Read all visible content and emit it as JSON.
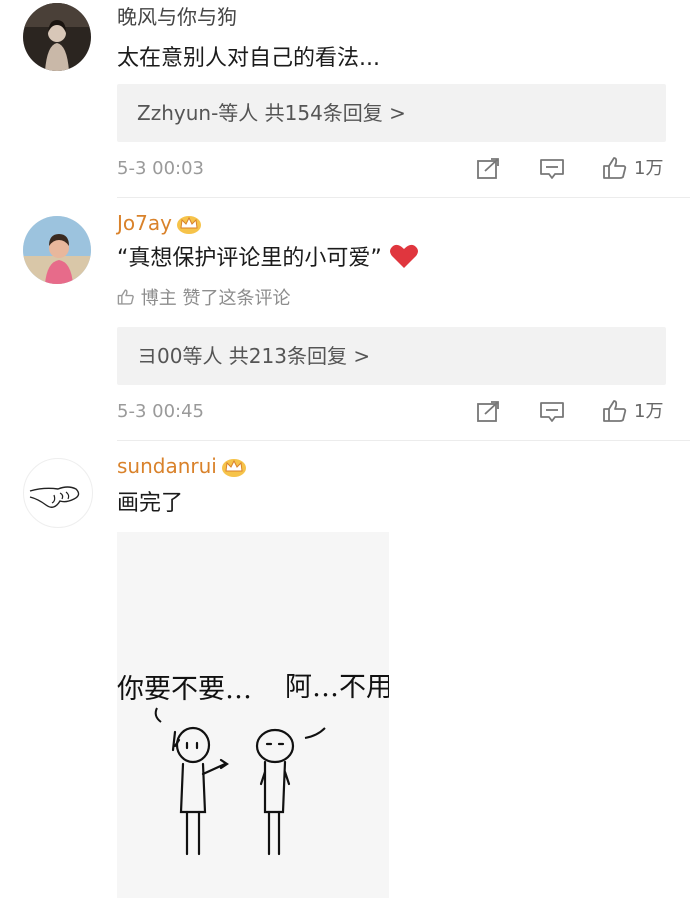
{
  "comments": [
    {
      "username": "晚风与你与狗",
      "text": "太在意别人对自己的看法...",
      "replies": "Zzhyun-等人  共154条回复 >",
      "time": "5-3 00:03",
      "likes": "1万"
    },
    {
      "username": "Jo7ay",
      "text": "“真想保护评论里的小可爱”",
      "liked_by": "博主 赞了这条评论",
      "replies": "ヨ00等人  共213条回复 >",
      "time": "5-3 00:45",
      "likes": "1万"
    },
    {
      "username": "sundanrui",
      "text": "画完了",
      "drawing": {
        "left_speech": "你要不要…",
        "right_speech": "阿…不用"
      }
    }
  ],
  "colors": {
    "vip_name": "#d9822b",
    "reply_bg": "#f2f2f2",
    "heart": "#e0363e"
  },
  "icons": [
    "share-icon",
    "comment-icon",
    "like-icon",
    "crown-icon",
    "thumb-icon",
    "heart-icon"
  ]
}
